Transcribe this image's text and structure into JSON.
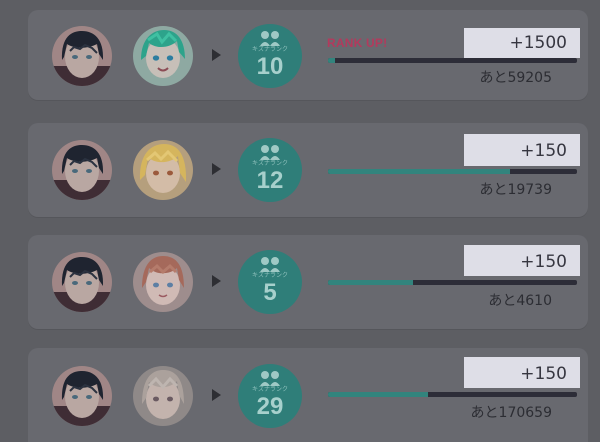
{
  "colors": {
    "background": "#5d5e63",
    "card": "#68696f",
    "rank_badge": "#2f7e79",
    "rank_up_text": "#b23a5d",
    "bar_fill": "#32847d",
    "bar_track": "#2d2d38",
    "points_box": "#dedee7"
  },
  "rows": [
    {
      "left_avatar_icon": "character-portrait-icon",
      "right_avatar_icon": "character-portrait-icon",
      "rank_label": "キズナランク",
      "rank": "10",
      "rank_up": "RANK UP!",
      "points": "+1500",
      "remaining": "あと59205",
      "progress": 0.03
    },
    {
      "left_avatar_icon": "character-portrait-icon",
      "right_avatar_icon": "character-portrait-icon",
      "rank_label": "キズナランク",
      "rank": "12",
      "points": "+150",
      "remaining": "あと19739",
      "progress": 0.73
    },
    {
      "left_avatar_icon": "character-portrait-icon",
      "right_avatar_icon": "character-portrait-icon",
      "rank_label": "キズナランク",
      "rank": "5",
      "points": "+150",
      "remaining": "あと4610",
      "progress": 0.34
    },
    {
      "left_avatar_icon": "character-portrait-icon",
      "right_avatar_icon": "character-portrait-icon",
      "rank_label": "キズナランク",
      "rank": "29",
      "points": "+150",
      "remaining": "あと170659",
      "progress": 0.4
    }
  ]
}
